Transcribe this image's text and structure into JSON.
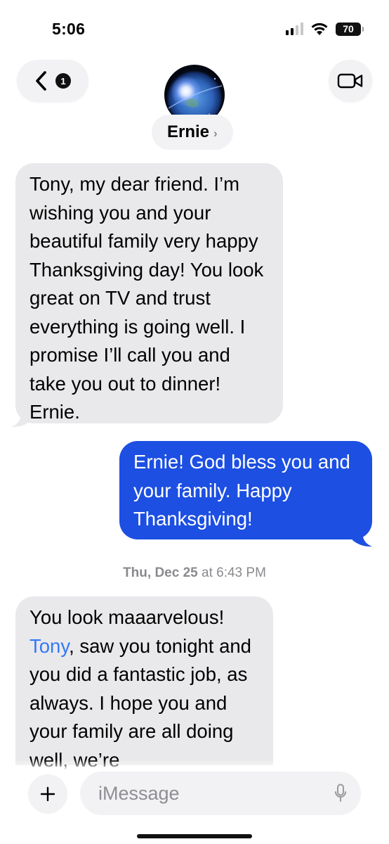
{
  "status_bar": {
    "time": "5:06",
    "battery_level": "70",
    "signal_bars_active": 2,
    "signal_bars_total": 4
  },
  "header": {
    "back_badge_count": "1",
    "contact_name": "Ernie",
    "contact_chevron": "›",
    "icons": {
      "back": "chevron-left-icon",
      "video": "video-camera-icon",
      "avatar": "earth-space-avatar"
    }
  },
  "messages": [
    {
      "direction": "incoming",
      "text": "Tony, my dear friend. I’m wishing you and your beautiful family very happy Thanksgiving day! You look great on TV and trust everything is going well. I promise I’ll call you and take you out to dinner! Ernie."
    },
    {
      "direction": "outgoing",
      "text": "Ernie! God bless you and your family. Happy Thanksgiving!"
    },
    {
      "direction": "incoming",
      "prefix": "You look maaarvelous!",
      "mention": "Tony",
      "suffix": ", saw you tonight and you did a fantastic job, as  always. I hope you and your family are all doing well, we’re"
    }
  ],
  "timestamp": {
    "date": "Thu, Dec 25",
    "time_prefix": "at 6:43 PM"
  },
  "composer": {
    "placeholder": "iMessage",
    "value": "",
    "plus_label": "+"
  },
  "colors": {
    "incoming_bubble": "#e9e9eb",
    "outgoing_bubble": "#1c4fe2",
    "mention": "#3479f6",
    "secondary_text": "#8a8a8e"
  }
}
